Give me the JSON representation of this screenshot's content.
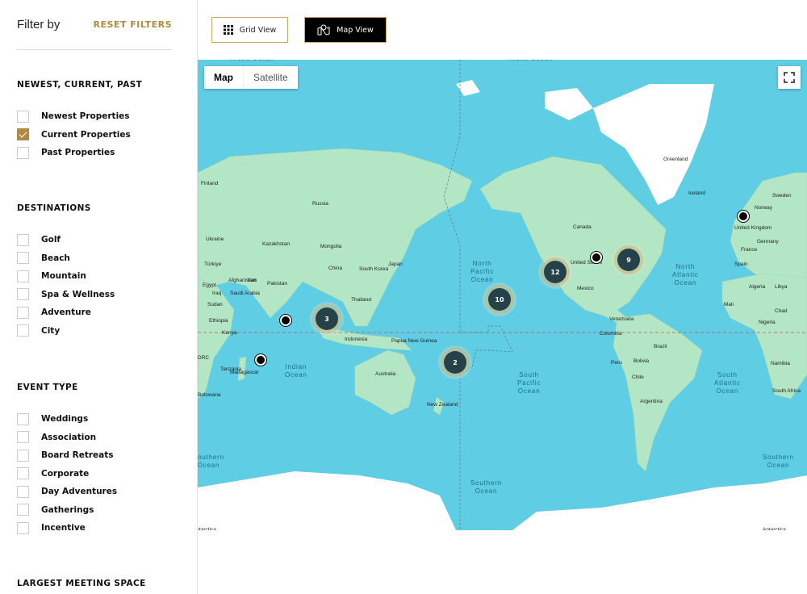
{
  "sidebar": {
    "title": "Filter by",
    "reset": "RESET FILTERS",
    "sections": [
      {
        "title": "NEWEST, CURRENT, PAST",
        "options": [
          {
            "label": "Newest Properties",
            "checked": false
          },
          {
            "label": "Current Properties",
            "checked": true
          },
          {
            "label": "Past Properties",
            "checked": false
          }
        ]
      },
      {
        "title": "DESTINATIONS",
        "options": [
          {
            "label": "Golf",
            "checked": false
          },
          {
            "label": "Beach",
            "checked": false
          },
          {
            "label": "Mountain",
            "checked": false
          },
          {
            "label": "Spa & Wellness",
            "checked": false
          },
          {
            "label": "Adventure",
            "checked": false
          },
          {
            "label": "City",
            "checked": false
          }
        ]
      },
      {
        "title": "EVENT TYPE",
        "options": [
          {
            "label": "Weddings",
            "checked": false
          },
          {
            "label": "Association",
            "checked": false
          },
          {
            "label": "Board Retreats",
            "checked": false
          },
          {
            "label": "Corporate",
            "checked": false
          },
          {
            "label": "Day Adventures",
            "checked": false
          },
          {
            "label": "Gatherings",
            "checked": false
          },
          {
            "label": "Incentive",
            "checked": false
          }
        ]
      },
      {
        "title": "LARGEST MEETING SPACE",
        "options": []
      }
    ]
  },
  "views": {
    "grid": "Grid View",
    "map": "Map View",
    "active": "map"
  },
  "map": {
    "type_map": "Map",
    "type_satellite": "Satellite",
    "active_type": "Map",
    "clusters": [
      "3",
      "12",
      "9",
      "10",
      "2"
    ],
    "oceans": [
      "Arctic Ocean",
      "Arctic Ocean",
      "North\nPacific\nOcean",
      "North\nAtlantic\nOcean",
      "South\nPacific\nOcean",
      "South\nAtlantic\nOcean",
      "Indian\nOcean",
      "Southern\nOcean",
      "Southern\nOcean",
      "Southern\nOcean"
    ],
    "labels": [
      "Greenland",
      "Iceland",
      "Norway",
      "Sweden",
      "Finland",
      "Russia",
      "Kazakhstan",
      "Mongolia",
      "China",
      "South Korea",
      "Japan",
      "Türkiye",
      "Afghanistan",
      "Pakistan",
      "Iraq",
      "Iran",
      "Egypt",
      "Saudi Arabia",
      "Sudan",
      "Ethiopia",
      "Kenya",
      "Thailand",
      "Indonesia",
      "Papua New Guinea",
      "Australia",
      "New Zealand",
      "Madagascar",
      "Canada",
      "United States",
      "Mexico",
      "Venezuela",
      "Colombia",
      "Brazil",
      "Peru",
      "Bolivia",
      "Chile",
      "Argentina",
      "United Kingdom",
      "Germany",
      "France",
      "Spain",
      "Algeria",
      "Libya",
      "Mali",
      "Chad",
      "Nigeria",
      "Namibia",
      "South Africa",
      "Ukraine",
      "DRC",
      "Tanzania",
      "Botswana",
      "Antarctica",
      "Antarctica"
    ],
    "colors": {
      "ocean": "#5fcde4",
      "land": "#b3e6c5",
      "ice": "#ffffff",
      "cluster": "#25414a",
      "accent": "#b08a3e"
    }
  }
}
